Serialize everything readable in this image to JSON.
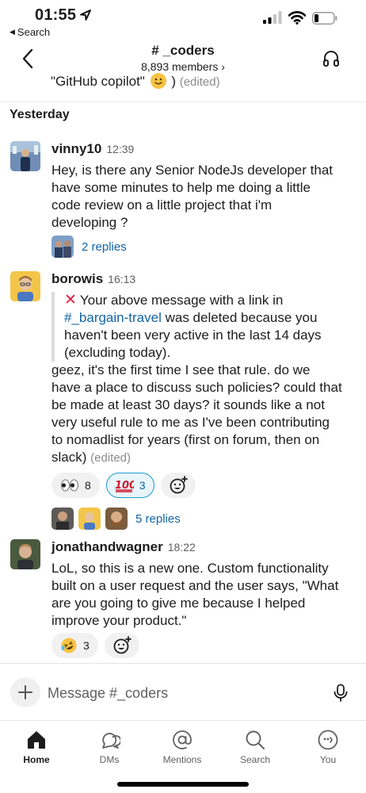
{
  "status_bar": {
    "time": "01:55",
    "back_app_label": "Search"
  },
  "header": {
    "channel": "# _coders",
    "members": "8,893 members ›"
  },
  "previous_message": {
    "text": "\"GitHub copilot\"",
    "edited": "(edited)"
  },
  "day_divider": "Yesterday",
  "messages": [
    {
      "author": "vinny10",
      "time": "12:39",
      "lines": [
        "Hey, is there any Senior NodeJs developer that",
        "have some minutes to help me doing a little",
        "code review on a little project that i'm",
        "developing ?"
      ],
      "replies": "2 replies"
    },
    {
      "author": "borowis",
      "time": "16:13",
      "quote": {
        "line1": "Your above message with a link in",
        "link": "#_bargain-travel",
        "line2_rest": " was deleted because you",
        "line3": "haven't been very active in the last 14 days",
        "line4": "(excluding today)."
      },
      "lines": [
        "geez, it's the first time I see that rule. do we",
        "have a place to discuss such policies? could that",
        "be made at least 30 days? it sounds like a not",
        "very useful rule to me as I've been contributing",
        "to nomadlist for years (first on forum, then on",
        "slack)"
      ],
      "edited": "(edited)",
      "reactions": [
        {
          "emoji": "eyes",
          "count": "8"
        },
        {
          "emoji": "100",
          "count": "3"
        }
      ],
      "replies": "5 replies"
    },
    {
      "author": "jonathandwagner",
      "time": "18:22",
      "lines": [
        "LoL, so this is a new one. Custom functionality",
        "built on a user request and the user says, \"What",
        "are you going to give me because I helped",
        "improve your product.\""
      ],
      "reactions": [
        {
          "emoji": "rofl",
          "count": "3"
        }
      ]
    }
  ],
  "composer": {
    "placeholder": "Message #_coders"
  },
  "tabs": [
    {
      "label": "Home",
      "icon": "home-icon"
    },
    {
      "label": "DMs",
      "icon": "dms-icon"
    },
    {
      "label": "Mentions",
      "icon": "at-icon"
    },
    {
      "label": "Search",
      "icon": "search-icon"
    },
    {
      "label": "You",
      "icon": "you-icon"
    }
  ],
  "colors": {
    "link": "#1264a3",
    "mine_reaction_border": "#1d9bd1",
    "error_red": "#e01e3c"
  }
}
